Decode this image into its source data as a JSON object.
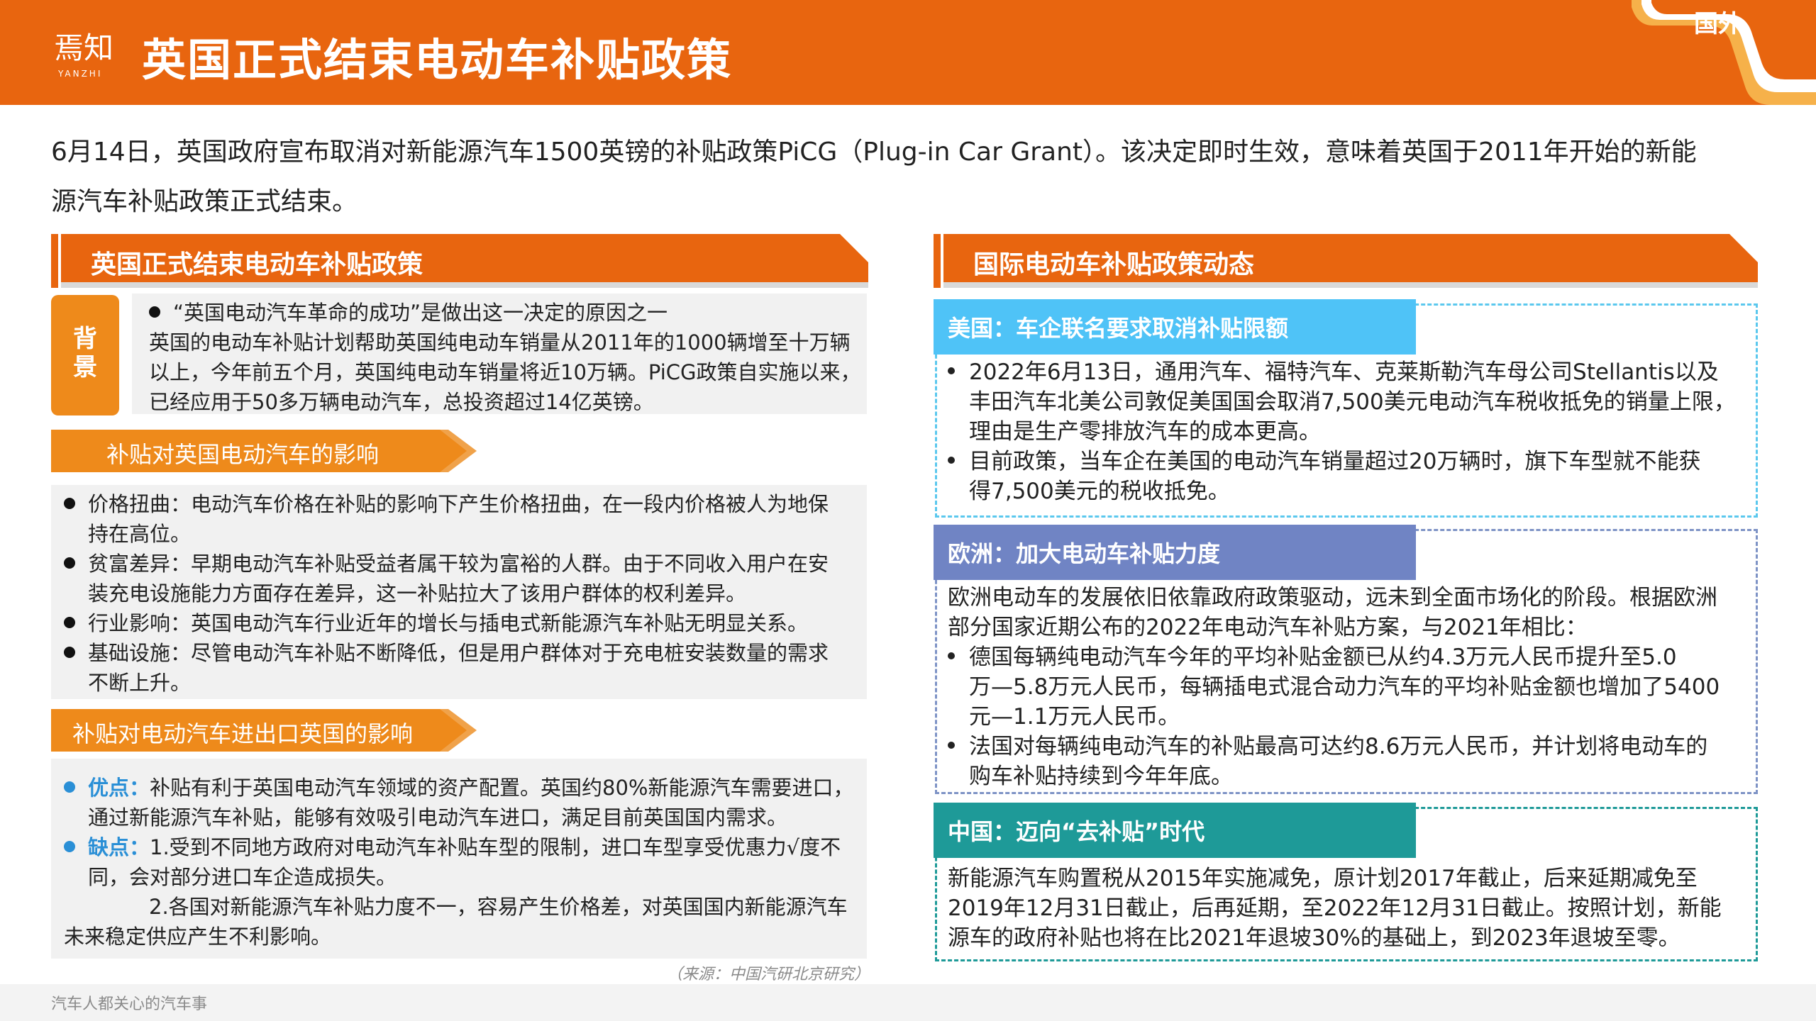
{
  "header": {
    "logo_text": "焉知",
    "logo_sub": "YANZHI",
    "title": "英国正式结束电动车补贴政策",
    "tag": "国外"
  },
  "intro": [
    "6月14日，英国政府宣布取消对新能源汽车1500英镑的补贴政策PiCG（Plug-in Car Grant）。该决定即时生效，意味着英国于2011年开始的新能",
    "源汽车补贴政策正式结束。"
  ],
  "left": {
    "section_title": "英国正式结束电动车补贴政策",
    "background": {
      "tag": [
        "背",
        "景"
      ],
      "lines": [
        "“英国电动汽车革命的成功”是做出这一决定的原因之一",
        "英国的电动车补贴计划帮助英国纯电动车销量从2011年的1000辆增至十万辆",
        "以上，今年前五个月，英国纯电动车销量将近10万辆。PiCG政策自实施以来，",
        "已经应用于50多万辆电动汽车，总投资超过14亿英镑。"
      ]
    },
    "impact": {
      "title": "补贴对英国电动汽车的影响",
      "items": [
        [
          "价格扭曲：电动汽车价格在补贴的影响下产生价格扭曲，在一段内价格被人为地保",
          "持在高位。"
        ],
        [
          "贫富差异：早期电动汽车补贴受益者属干较为富裕的人群。由于不同收入用户在安",
          "装充电设施能力方面存在差异，这一补贴拉大了该用户群体的权利差异。"
        ],
        [
          "行业影响：英国电动汽车行业近年的增长与插电式新能源汽车补贴无明显关系。"
        ],
        [
          "基础设施：尽管电动汽车补贴不断降低，但是用户群体对于充电桩安装数量的需求",
          "不断上升。"
        ]
      ]
    },
    "trade": {
      "title": "补贴对电动汽车进出口英国的影响",
      "pro_label": "优点：",
      "pro_lines": [
        "补贴有利于英国电动汽车领域的资产配置。英国约80%新能源汽车需要进口，",
        "通过新能源汽车补贴，能够有效吸引电动汽车进口，满足目前英国国内需求。"
      ],
      "con_label": "缺点：",
      "con_lines": [
        "1.受到不同地方政府对电动汽车补贴车型的限制，进口车型享受优惠力√度不",
        "同，会对部分进口车企造成损失。"
      ],
      "con_lines_2": [
        "2.各国对新能源汽车补贴力度不一，容易产生价格差，对英国国内新能源汽车",
        "未来稳定供应产生不利影响。"
      ]
    },
    "source": "（来源：中国汽研北京研究）"
  },
  "right": {
    "section_title": "国际电动车补贴政策动态",
    "usa": {
      "title": "美国：车企联名要求取消补贴限额",
      "items": [
        [
          "2022年6月13日，通用汽车、福特汽车、克莱斯勒汽车母公司Stellantis以及",
          "丰田汽车北美公司敦促美国国会取消7,500美元电动汽车税收抵免的销量上限，",
          "理由是生产零排放汽车的成本更高。"
        ],
        [
          "目前政策，当车企在美国的电动汽车销量超过20万辆时，旗下车型就不能获",
          "得7,500美元的税收抵免。"
        ]
      ]
    },
    "europe": {
      "title": "欧洲：加大电动车补贴力度",
      "intro": [
        "欧洲电动车的发展依旧依靠政府政策驱动，远未到全面市场化的阶段。根据欧洲",
        "部分国家近期公布的2022年电动汽车补贴方案，与2021年相比："
      ],
      "items": [
        [
          "德国每辆纯电动汽车今年的平均补贴金额已从约4.3万元人民币提升至5.0",
          "万—5.8万元人民币，每辆插电式混合动力汽车的平均补贴金额也增加了5400",
          "元—1.1万元人民币。"
        ],
        [
          "法国对每辆纯电动汽车的补贴最高可达约8.6万元人民币，并计划将电动车的",
          "购车补贴持续到今年年底。"
        ]
      ]
    },
    "china": {
      "title": "中国：迈向“去补贴”时代",
      "lines": [
        "新能源汽车购置税从2015年实施减免，原计划2017年截止，后来延期减免至",
        "2019年12月31日截止，后再延期，至2022年12月31日截止。按照计划，新能",
        "源车的政府补贴也将在比2021年退坡30%的基础上，到2023年退坡至零。"
      ]
    }
  },
  "footer": {
    "text": "汽车人都关心的汽车事"
  },
  "colors": {
    "brand_orange": "#e8650f",
    "light_orange": "#ee8a1b",
    "usa_blue": "#4fc3f7",
    "europe_blue": "#7084c4",
    "china_teal": "#1e9a98"
  }
}
